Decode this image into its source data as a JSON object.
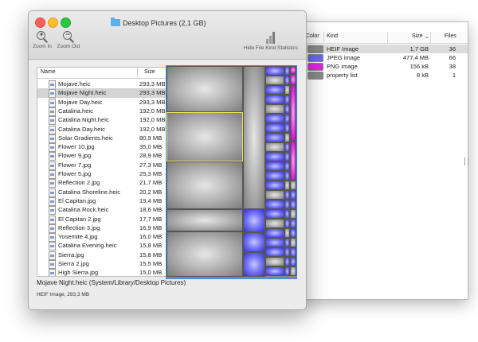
{
  "window": {
    "title": "Desktop Pictures (2,1 GB)",
    "toolbar": {
      "zoom_in": "Zoom In",
      "zoom_out": "Zoom Out",
      "hide_stats": "Hide File Kind Statistics"
    }
  },
  "file_list": {
    "col_name": "Name",
    "col_size": "Size",
    "selected_index": 1,
    "rows": [
      {
        "name": "Mojave.heic",
        "size": "293,3 MB"
      },
      {
        "name": "Mojave Night.heic",
        "size": "293,3 MB"
      },
      {
        "name": "Mojave Day.heic",
        "size": "293,3 MB"
      },
      {
        "name": "Catalina.heic",
        "size": "192,0 MB"
      },
      {
        "name": "Catalina Night.heic",
        "size": "192,0 MB"
      },
      {
        "name": "Catalina Day.heic",
        "size": "192,0 MB"
      },
      {
        "name": "Solar Gradients.heic",
        "size": "80,9 MB"
      },
      {
        "name": "Flower 10.jpg",
        "size": "35,0 MB"
      },
      {
        "name": "Flower 9.jpg",
        "size": "28,9 MB"
      },
      {
        "name": "Flower 7.jpg",
        "size": "27,3 MB"
      },
      {
        "name": "Flower 5.jpg",
        "size": "25,3 MB"
      },
      {
        "name": "Reflection 2.jpg",
        "size": "21,7 MB"
      },
      {
        "name": "Catalina Shoreline.heic",
        "size": "20,2 MB"
      },
      {
        "name": "El Capitan.jpg",
        "size": "19,4 MB"
      },
      {
        "name": "Catalina Rock.heic",
        "size": "18,6 MB"
      },
      {
        "name": "El Capitan 2.jpg",
        "size": "17,7 MB"
      },
      {
        "name": "Reflection 3.jpg",
        "size": "16,9 MB"
      },
      {
        "name": "Yosemite 4.jpg",
        "size": "16,0 MB"
      },
      {
        "name": "Catalina Evening.heic",
        "size": "15,8 MB"
      },
      {
        "name": "Sierra.jpg",
        "size": "15,8 MB"
      },
      {
        "name": "Sierra 2.jpg",
        "size": "15,5 MB"
      },
      {
        "name": "High Sierra.jpg",
        "size": "15,0 MB"
      }
    ]
  },
  "status": {
    "path": "Mojave Night.heic (System/Library/Desktop Pictures)",
    "detail": "HEIF Image, 293,3 MB"
  },
  "kind_stats": {
    "col_color": "Color",
    "col_kind": "Kind",
    "col_size": "Size",
    "col_files": "Files",
    "rows": [
      {
        "color": "#8a8a8a",
        "kind": "HEIF Image",
        "size": "1,7 GB",
        "files": "36"
      },
      {
        "color": "#6a6af0",
        "kind": "JPEG image",
        "size": "477,4 MB",
        "files": "66"
      },
      {
        "color": "#d82cd8",
        "kind": "PNG image",
        "size": "156 kB",
        "files": "38"
      },
      {
        "color": "#8a8a8a",
        "kind": "property list",
        "size": "8 kB",
        "files": "1"
      }
    ]
  },
  "colors": {
    "selection_highlight": "#f2e44a",
    "treemap_border": "#3b8cf0",
    "heif": "#8a8a8a",
    "jpeg": "#6a6af0",
    "png": "#d82cd8"
  }
}
